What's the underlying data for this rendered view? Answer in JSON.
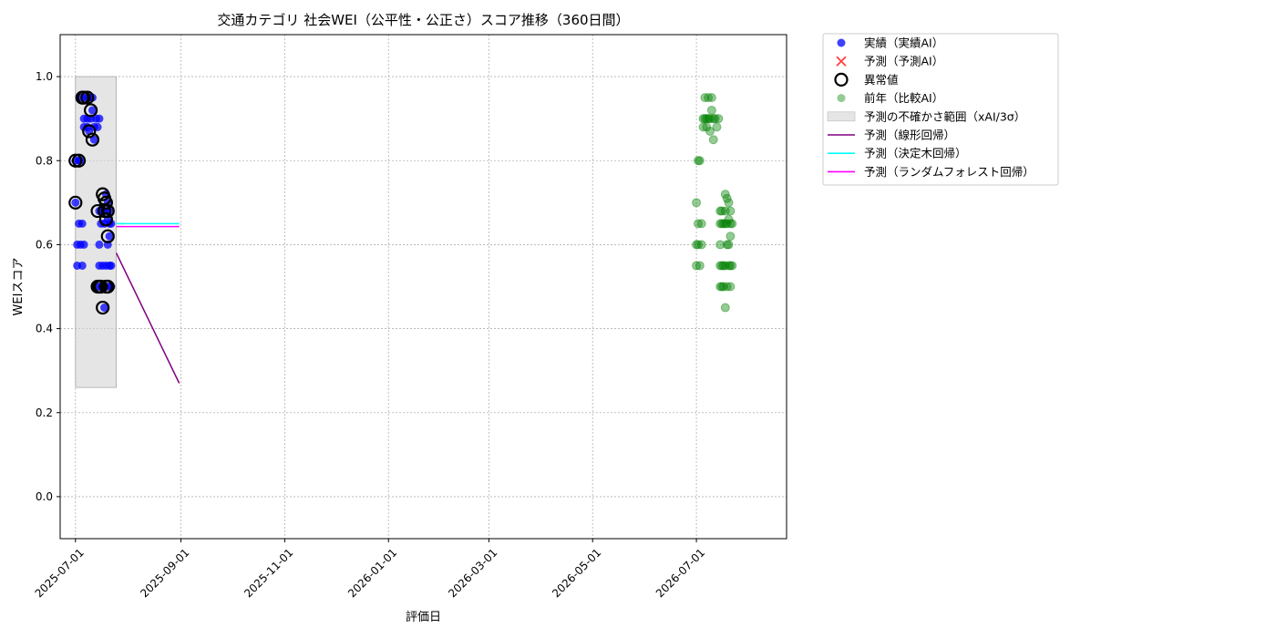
{
  "chart_data": {
    "type": "scatter",
    "title": "交通カテゴリ 社会WEI（公平性・公正さ）スコア推移（360日間）",
    "xlabel": "評価日",
    "ylabel": "WEIスコア",
    "xlim": [
      "2025-06-22",
      "2026-08-23"
    ],
    "ylim": [
      -0.1,
      1.1
    ],
    "x_ticks": [
      "2025-07-01",
      "2025-09-01",
      "2025-11-01",
      "2026-01-01",
      "2026-03-01",
      "2026-05-01",
      "2026-07-01"
    ],
    "y_ticks": [
      0.0,
      0.2,
      0.4,
      0.6,
      0.8,
      1.0
    ],
    "grid": true,
    "legend_position": "outside-top-right",
    "colors": {
      "actual": "#0000ff",
      "forecast": "#ff0000",
      "anomaly": "#000000",
      "previous_year": "#008000",
      "uncertainty": "#d3d3d3",
      "linear": "#800080",
      "tree": "#00ffff",
      "forest": "#ff00ff"
    },
    "legend": [
      {
        "label": "実績（実績AI）",
        "kind": "dot",
        "key": "actual"
      },
      {
        "label": "予測（予測AI）",
        "kind": "x",
        "key": "forecast"
      },
      {
        "label": "異常値",
        "kind": "ring",
        "key": "anomaly"
      },
      {
        "label": "前年（比較AI）",
        "kind": "dot-faded",
        "key": "previous_year"
      },
      {
        "label": "予測の不確かさ範囲（xAI/3σ）",
        "kind": "band",
        "key": "uncertainty"
      },
      {
        "label": "予測（線形回帰）",
        "kind": "line",
        "key": "linear"
      },
      {
        "label": "予測（決定木回帰）",
        "kind": "line",
        "key": "tree"
      },
      {
        "label": "予測（ランダムフォレスト回帰）",
        "kind": "line",
        "key": "forest"
      }
    ],
    "series": [
      {
        "name": "実績（実績AI）",
        "points": [
          [
            "2025-07-01",
            0.7
          ],
          [
            "2025-07-01",
            0.8
          ],
          [
            "2025-07-02",
            0.6
          ],
          [
            "2025-07-02",
            0.55
          ],
          [
            "2025-07-03",
            0.65
          ],
          [
            "2025-07-03",
            0.8
          ],
          [
            "2025-07-04",
            0.6
          ],
          [
            "2025-07-04",
            0.8
          ],
          [
            "2025-07-05",
            0.95
          ],
          [
            "2025-07-05",
            0.65
          ],
          [
            "2025-07-05",
            0.55
          ],
          [
            "2025-07-06",
            0.9
          ],
          [
            "2025-07-06",
            0.6
          ],
          [
            "2025-07-06",
            0.88
          ],
          [
            "2025-07-07",
            0.95
          ],
          [
            "2025-07-08",
            0.9
          ],
          [
            "2025-07-08",
            0.88
          ],
          [
            "2025-07-09",
            0.95
          ],
          [
            "2025-07-09",
            0.87
          ],
          [
            "2025-07-10",
            0.9
          ],
          [
            "2025-07-11",
            0.92
          ],
          [
            "2025-07-11",
            0.95
          ],
          [
            "2025-07-12",
            0.88
          ],
          [
            "2025-07-12",
            0.85
          ],
          [
            "2025-07-13",
            0.9
          ],
          [
            "2025-07-14",
            0.88
          ],
          [
            "2025-07-15",
            0.9
          ],
          [
            "2025-07-15",
            0.68
          ],
          [
            "2025-07-15",
            0.55
          ],
          [
            "2025-07-15",
            0.5
          ],
          [
            "2025-07-15",
            0.6
          ],
          [
            "2025-07-16",
            0.65
          ],
          [
            "2025-07-16",
            0.5
          ],
          [
            "2025-07-17",
            0.68
          ],
          [
            "2025-07-17",
            0.55
          ],
          [
            "2025-07-17",
            0.5
          ],
          [
            "2025-07-18",
            0.65
          ],
          [
            "2025-07-18",
            0.5
          ],
          [
            "2025-07-18",
            0.45
          ],
          [
            "2025-07-19",
            0.72
          ],
          [
            "2025-07-19",
            0.68
          ],
          [
            "2025-07-19",
            0.55
          ],
          [
            "2025-07-20",
            0.7
          ],
          [
            "2025-07-20",
            0.66
          ],
          [
            "2025-07-20",
            0.6
          ],
          [
            "2025-07-20",
            0.5
          ],
          [
            "2025-07-21",
            0.68
          ],
          [
            "2025-07-21",
            0.65
          ],
          [
            "2025-07-21",
            0.55
          ],
          [
            "2025-07-21",
            0.62
          ],
          [
            "2025-07-22",
            0.65
          ],
          [
            "2025-07-22",
            0.55
          ],
          [
            "2025-07-22",
            0.5
          ]
        ]
      },
      {
        "name": "異常値",
        "points": [
          [
            "2025-07-01",
            0.7
          ],
          [
            "2025-07-01",
            0.8
          ],
          [
            "2025-07-03",
            0.8
          ],
          [
            "2025-07-05",
            0.95
          ],
          [
            "2025-07-06",
            0.95
          ],
          [
            "2025-07-08",
            0.95
          ],
          [
            "2025-07-09",
            0.87
          ],
          [
            "2025-07-10",
            0.92
          ],
          [
            "2025-07-11",
            0.85
          ],
          [
            "2025-07-14",
            0.68
          ],
          [
            "2025-07-14",
            0.5
          ],
          [
            "2025-07-15",
            0.5
          ],
          [
            "2025-07-16",
            0.5
          ],
          [
            "2025-07-17",
            0.45
          ],
          [
            "2025-07-17",
            0.72
          ],
          [
            "2025-07-18",
            0.71
          ],
          [
            "2025-07-18",
            0.68
          ],
          [
            "2025-07-19",
            0.7
          ],
          [
            "2025-07-19",
            0.66
          ],
          [
            "2025-07-20",
            0.68
          ],
          [
            "2025-07-20",
            0.62
          ],
          [
            "2025-07-19",
            0.5
          ],
          [
            "2025-07-20",
            0.5
          ]
        ]
      },
      {
        "name": "前年（比較AI）",
        "points": [
          [
            "2026-07-01",
            0.7
          ],
          [
            "2026-07-01",
            0.6
          ],
          [
            "2026-07-01",
            0.55
          ],
          [
            "2026-07-02",
            0.8
          ],
          [
            "2026-07-02",
            0.65
          ],
          [
            "2026-07-02",
            0.6
          ],
          [
            "2026-07-03",
            0.8
          ],
          [
            "2026-07-03",
            0.55
          ],
          [
            "2026-07-04",
            0.65
          ],
          [
            "2026-07-04",
            0.6
          ],
          [
            "2026-07-05",
            0.9
          ],
          [
            "2026-07-05",
            0.88
          ],
          [
            "2026-07-06",
            0.95
          ],
          [
            "2026-07-06",
            0.9
          ],
          [
            "2026-07-07",
            0.88
          ],
          [
            "2026-07-07",
            0.9
          ],
          [
            "2026-07-08",
            0.95
          ],
          [
            "2026-07-08",
            0.9
          ],
          [
            "2026-07-09",
            0.87
          ],
          [
            "2026-07-09",
            0.9
          ],
          [
            "2026-07-10",
            0.95
          ],
          [
            "2026-07-10",
            0.92
          ],
          [
            "2026-07-11",
            0.9
          ],
          [
            "2026-07-11",
            0.85
          ],
          [
            "2026-07-12",
            0.9
          ],
          [
            "2026-07-13",
            0.88
          ],
          [
            "2026-07-14",
            0.9
          ],
          [
            "2026-07-15",
            0.68
          ],
          [
            "2026-07-15",
            0.65
          ],
          [
            "2026-07-15",
            0.6
          ],
          [
            "2026-07-15",
            0.55
          ],
          [
            "2026-07-15",
            0.5
          ],
          [
            "2026-07-16",
            0.68
          ],
          [
            "2026-07-16",
            0.65
          ],
          [
            "2026-07-16",
            0.55
          ],
          [
            "2026-07-16",
            0.5
          ],
          [
            "2026-07-17",
            0.65
          ],
          [
            "2026-07-17",
            0.55
          ],
          [
            "2026-07-17",
            0.5
          ],
          [
            "2026-07-18",
            0.72
          ],
          [
            "2026-07-18",
            0.68
          ],
          [
            "2026-07-18",
            0.65
          ],
          [
            "2026-07-18",
            0.55
          ],
          [
            "2026-07-18",
            0.45
          ],
          [
            "2026-07-19",
            0.71
          ],
          [
            "2026-07-19",
            0.65
          ],
          [
            "2026-07-19",
            0.6
          ],
          [
            "2026-07-19",
            0.5
          ],
          [
            "2026-07-20",
            0.7
          ],
          [
            "2026-07-20",
            0.66
          ],
          [
            "2026-07-20",
            0.6
          ],
          [
            "2026-07-20",
            0.55
          ],
          [
            "2026-07-21",
            0.68
          ],
          [
            "2026-07-21",
            0.65
          ],
          [
            "2026-07-21",
            0.62
          ],
          [
            "2026-07-21",
            0.55
          ],
          [
            "2026-07-21",
            0.5
          ],
          [
            "2026-07-22",
            0.65
          ],
          [
            "2026-07-22",
            0.55
          ]
        ]
      },
      {
        "name": "予測の不確かさ範囲（xAI/3σ）",
        "x": [
          "2025-07-01",
          "2025-07-25"
        ],
        "y_low": 0.26,
        "y_high": 1.0
      },
      {
        "name": "予測（線形回帰）",
        "points": [
          [
            "2025-07-25",
            0.58
          ],
          [
            "2025-08-31",
            0.27
          ]
        ]
      },
      {
        "name": "予測（決定木回帰）",
        "points": [
          [
            "2025-07-25",
            0.65
          ],
          [
            "2025-08-31",
            0.65
          ]
        ]
      },
      {
        "name": "予測（ランダムフォレスト回帰）",
        "points": [
          [
            "2025-07-25",
            0.643
          ],
          [
            "2025-08-31",
            0.643
          ]
        ]
      }
    ]
  }
}
